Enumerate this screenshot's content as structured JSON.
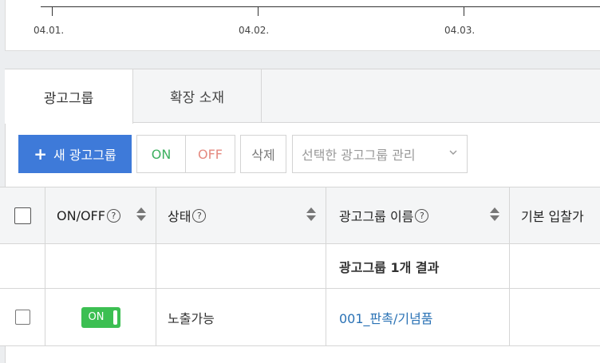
{
  "timeline": {
    "ticks": [
      "04.01.",
      "04.02.",
      "04.03."
    ]
  },
  "tabs": [
    {
      "label": "광고그룹",
      "active": true
    },
    {
      "label": "확장 소재",
      "active": false
    }
  ],
  "toolbar": {
    "new_label": "새 광고그룹",
    "on_label": "ON",
    "off_label": "OFF",
    "delete_label": "삭제",
    "manage_label": "선택한 광고그룹 관리"
  },
  "table": {
    "headers": {
      "onoff": "ON/OFF",
      "status": "상태",
      "name": "광고그룹 이름",
      "bid": "기본 입찰가"
    },
    "summary": "광고그룹 1개 결과",
    "rows": [
      {
        "onoff": "ON",
        "status": "노출가능",
        "name": "001_판촉/기념품"
      }
    ]
  },
  "icons": {
    "help": "question-circle-icon",
    "sort": "sort-icon",
    "plus": "plus-icon",
    "dropdown": "chevron-down-icon"
  },
  "colors": {
    "primary": "#3e7ad9",
    "on": "#3db060",
    "off": "#e58a80",
    "toggle": "#3cbf52",
    "link": "#2a72b5"
  }
}
